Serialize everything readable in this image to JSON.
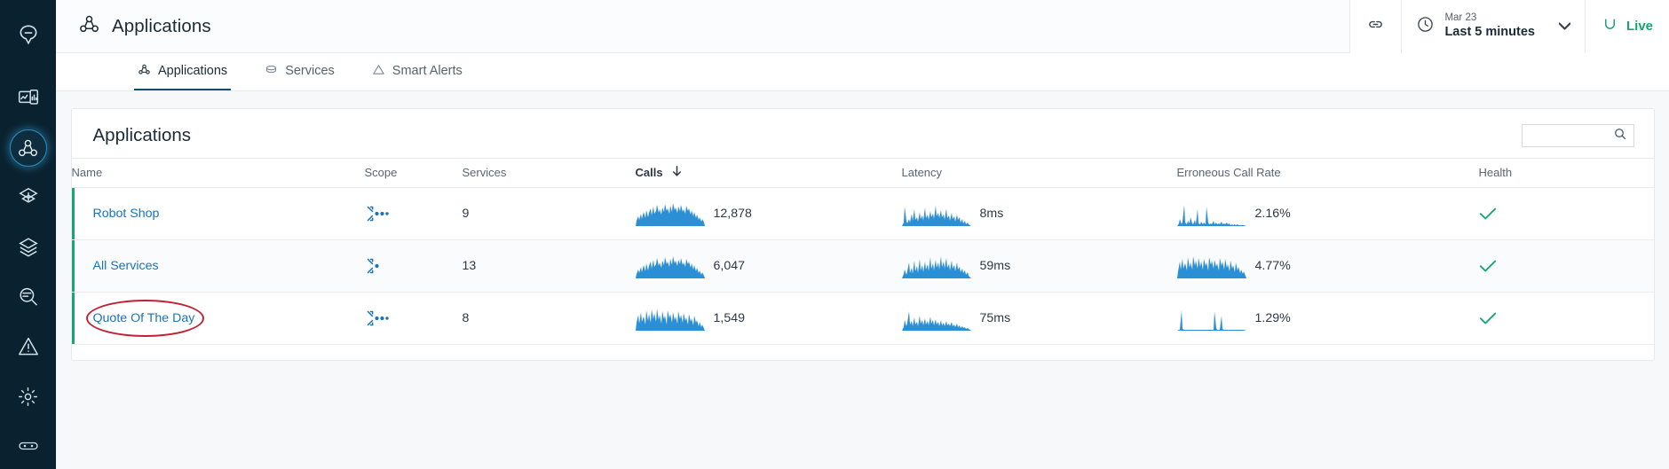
{
  "sidebar": {
    "items": [
      {
        "name": "logo-icon",
        "label": "Instana"
      },
      {
        "name": "dashboards-icon",
        "label": "Dashboards"
      },
      {
        "name": "applications-icon",
        "label": "Applications",
        "active": true
      },
      {
        "name": "infrastructure-icon",
        "label": "Infrastructure"
      },
      {
        "name": "layers-icon",
        "label": "Stack"
      },
      {
        "name": "analyze-search-icon",
        "label": "Analyze"
      },
      {
        "name": "alerts-warning-icon",
        "label": "Events"
      },
      {
        "name": "settings-gear-icon",
        "label": "Settings"
      },
      {
        "name": "more-dots-icon",
        "label": "More"
      }
    ]
  },
  "topbar": {
    "title": "Applications",
    "title_icon": "applications-icon",
    "link_icon": "link-icon",
    "time": {
      "icon": "clock-icon",
      "date": "Mar 23",
      "range": "Last 5 minutes",
      "caret_icon": "chevron-down-icon"
    },
    "live": {
      "icon": "refresh-icon",
      "label": "Live",
      "color": "#17a673"
    }
  },
  "tabs": [
    {
      "label": "Applications",
      "icon": "applications-icon",
      "active": true
    },
    {
      "label": "Services",
      "icon": "services-icon",
      "active": false
    },
    {
      "label": "Smart Alerts",
      "icon": "smart-alerts-icon",
      "active": false
    }
  ],
  "card": {
    "title": "Applications",
    "search": {
      "value": "",
      "placeholder": "",
      "icon": "search-icon"
    },
    "columns": [
      {
        "key": "name",
        "label": "Name",
        "sorted": false
      },
      {
        "key": "scope",
        "label": "Scope",
        "sorted": false
      },
      {
        "key": "svc",
        "label": "Services",
        "sorted": false
      },
      {
        "key": "calls",
        "label": "Calls",
        "sorted": true,
        "sort_dir": "desc",
        "sort_icon": "arrow-down-icon"
      },
      {
        "key": "lat",
        "label": "Latency",
        "sorted": false
      },
      {
        "key": "err",
        "label": "Erroneous Call Rate",
        "sorted": false
      },
      {
        "key": "health",
        "label": "Health",
        "sorted": false
      }
    ],
    "rows": [
      {
        "name": "Robot Shop",
        "scope_icon": "scope-multi-icon",
        "services": "9",
        "calls": "12,878",
        "latency": "8ms",
        "error_rate": "2.16%",
        "health_icon": "check-icon",
        "health_color": "#17a673",
        "status_color": "#17a673",
        "annotated": false
      },
      {
        "name": "All Services",
        "scope_icon": "scope-single-icon",
        "services": "13",
        "calls": "6,047",
        "latency": "59ms",
        "error_rate": "4.77%",
        "health_icon": "check-icon",
        "health_color": "#17a673",
        "status_color": "#17a673",
        "annotated": false
      },
      {
        "name": "Quote Of The Day",
        "scope_icon": "scope-multi-icon",
        "services": "8",
        "calls": "1,549",
        "latency": "75ms",
        "error_rate": "1.29%",
        "health_icon": "check-icon",
        "health_color": "#17a673",
        "status_color": "#17a673",
        "annotated": true,
        "annotation_color": "#c22033"
      }
    ]
  },
  "colors": {
    "sidebar_bg": "#0a2230",
    "accent_blue": "#1a73b8",
    "sparkline": "#2a8fd4",
    "green": "#17a673",
    "annotation_red": "#c22033"
  }
}
